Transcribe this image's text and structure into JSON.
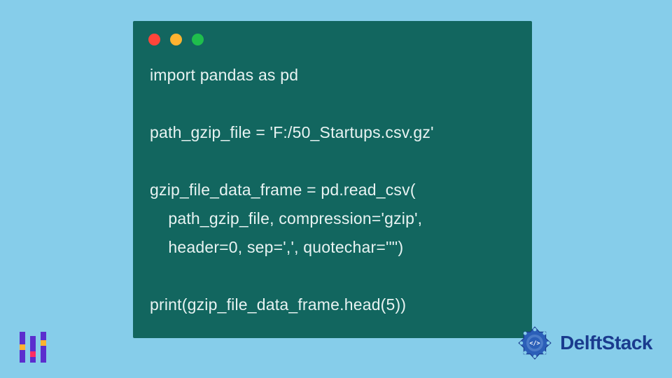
{
  "code": {
    "lines": [
      "import pandas as pd",
      "",
      "path_gzip_file = 'F:/50_Startups.csv.gz'",
      "",
      "gzip_file_data_frame = pd.read_csv(",
      "    path_gzip_file, compression='gzip',",
      "    header=0, sep=',', quotechar='\"')",
      "",
      "print(gzip_file_data_frame.head(5))"
    ]
  },
  "brand": {
    "name": "DelftStack"
  },
  "colors": {
    "bg": "#86cdea",
    "window": "#12665f",
    "text": "#e8f3f2",
    "brand_blue": "#1a3b8e"
  }
}
